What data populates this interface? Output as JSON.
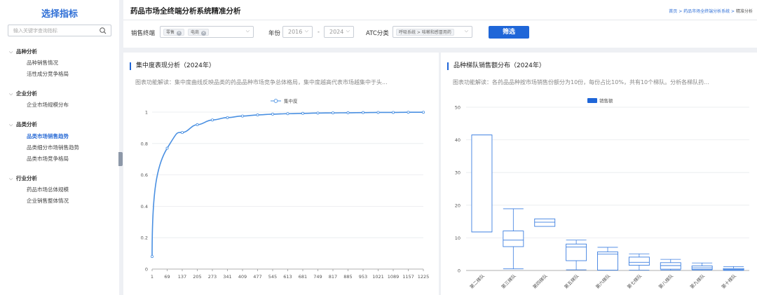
{
  "sidebar": {
    "title": "选择指标",
    "search_placeholder": "输入关键字查询指标",
    "groups": [
      {
        "label": "品种分析",
        "items": [
          {
            "label": "品种销售情况"
          },
          {
            "label": "活性成分竞争格局"
          }
        ]
      },
      {
        "label": "企业分析",
        "items": [
          {
            "label": "企业市场规模分布"
          }
        ]
      },
      {
        "label": "品类分析",
        "items": [
          {
            "label": "品类市场销售趋势",
            "active": true
          },
          {
            "label": "品类细分市场销售趋势"
          },
          {
            "label": "品类市场竞争格局"
          }
        ]
      },
      {
        "label": "行业分析",
        "items": [
          {
            "label": "药品市场总体规模"
          },
          {
            "label": "企业销售整体情况"
          }
        ]
      }
    ]
  },
  "header": {
    "title": "药品市场全终端分析系统精准分析",
    "breadcrumb": {
      "home": "首页",
      "parent": "药品市场全终端分析系统",
      "current": "精准分析"
    }
  },
  "filters": {
    "terminal_label": "销售终端",
    "terminal_tags": [
      "零售",
      "电商"
    ],
    "year_label": "年份",
    "year_from": "2016",
    "year_to": "2024",
    "year_sep": "-",
    "atc_label": "ATC分类",
    "atc_value": "呼吸系统 > 咳嗽和感冒用药",
    "button": "筛选"
  },
  "left_panel": {
    "title": "集中度表现分析（2024年）",
    "desc": "图表功能解读：集中度曲线反映品类的药品品种市场竞争总体格局，集中度越高代表市场越集中于头..."
  },
  "right_panel": {
    "title": "品种梯队销售额分布（2024年）",
    "desc": "图表功能解读：各药品品种按市场销售份额分为10份，每份占比10%，共有10个梯队。分析各梯队药..."
  },
  "colors": {
    "accent": "#1f66d8",
    "line": "#4a90e2",
    "box": "#3d7fe0"
  },
  "chart_data": [
    {
      "type": "line",
      "legend": [
        "集中度"
      ],
      "x_ticks": [
        "1",
        "69",
        "137",
        "205",
        "273",
        "341",
        "409",
        "477",
        "545",
        "613",
        "681",
        "749",
        "817",
        "885",
        "953",
        "1021",
        "1089",
        "1157",
        "1225"
      ],
      "y_ticks": [
        "0",
        "0.2",
        "0.4",
        "0.6",
        "0.8",
        "1"
      ],
      "ylim": [
        0,
        1
      ],
      "series": [
        {
          "name": "集中度",
          "values": [
            0.08,
            0.77,
            0.87,
            0.92,
            0.95,
            0.965,
            0.975,
            0.982,
            0.987,
            0.99,
            0.992,
            0.994,
            0.995,
            0.996,
            0.997,
            0.998,
            0.998,
            0.999,
            0.999
          ]
        }
      ]
    },
    {
      "type": "box",
      "legend": [
        "销售额"
      ],
      "categories": [
        "第二梯队",
        "第三梯队",
        "第四梯队",
        "第五梯队",
        "第六梯队",
        "第七梯队",
        "第八梯队",
        "第九梯队",
        "第十梯队"
      ],
      "y_ticks": [
        "0",
        "10",
        "20",
        "30",
        "40",
        "50"
      ],
      "ylim": [
        0,
        50
      ],
      "boxes": [
        {
          "min": 11.8,
          "q1": 11.8,
          "median": 11.8,
          "q3": 41.5,
          "max": 41.5
        },
        {
          "min": 0.5,
          "q1": 7.3,
          "median": 9.3,
          "q3": 12.1,
          "max": 18.9
        },
        {
          "min": 13.5,
          "q1": 13.5,
          "median": 14.8,
          "q3": 15.8,
          "max": 15.8
        },
        {
          "min": 0.2,
          "q1": 3.0,
          "median": 7.2,
          "q3": 8.1,
          "max": 9.3
        },
        {
          "min": 0.1,
          "q1": 0.1,
          "median": 5.0,
          "q3": 5.7,
          "max": 7.1
        },
        {
          "min": 0.1,
          "q1": 1.6,
          "median": 2.5,
          "q3": 4.1,
          "max": 5.1
        },
        {
          "min": 0.1,
          "q1": 0.4,
          "median": 1.5,
          "q3": 2.4,
          "max": 3.4
        },
        {
          "min": 0.1,
          "q1": 0.3,
          "median": 0.8,
          "q3": 1.4,
          "max": 2.3
        },
        {
          "min": 0.0,
          "q1": 0.1,
          "median": 0.3,
          "q3": 0.6,
          "max": 1.2
        }
      ]
    }
  ]
}
